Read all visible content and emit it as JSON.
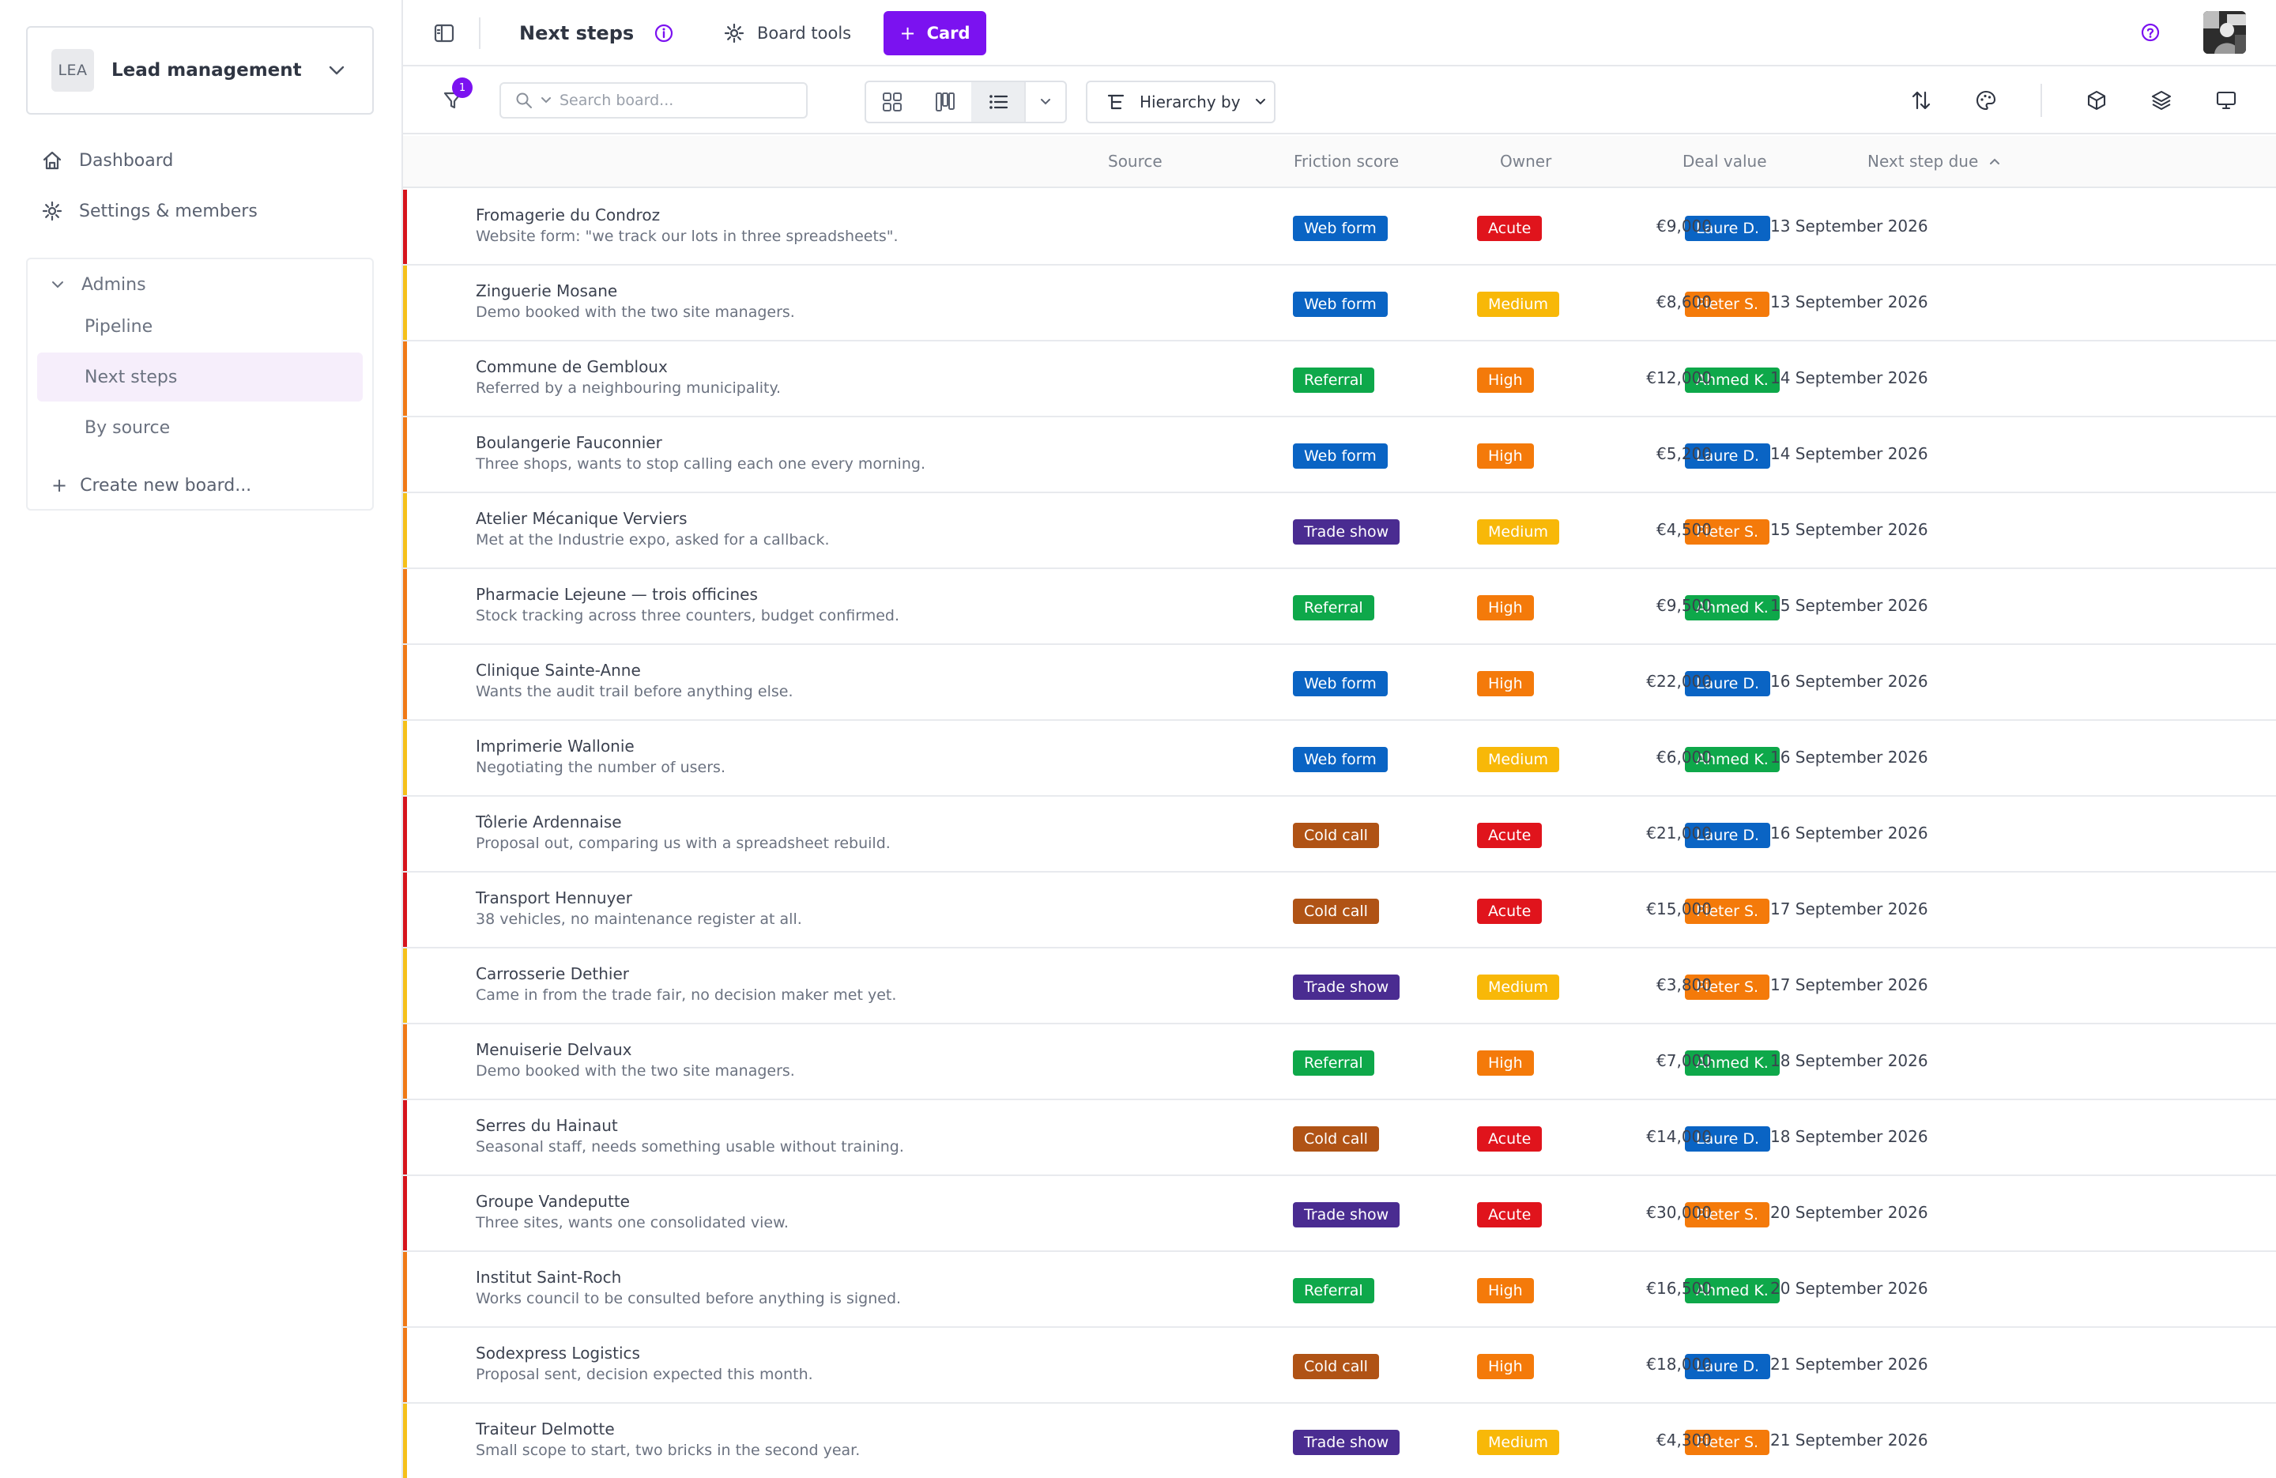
{
  "sidebar": {
    "workspace": {
      "initials": "LEA",
      "name": "Lead management"
    },
    "nav": [
      {
        "label": "Dashboard",
        "icon": "home-icon"
      },
      {
        "label": "Settings & members",
        "icon": "gear-icon"
      }
    ],
    "group": {
      "label": "Admins",
      "items": [
        {
          "label": "Pipeline",
          "active": false
        },
        {
          "label": "Next steps",
          "active": true
        },
        {
          "label": "By source",
          "active": false
        }
      ],
      "create_label": "Create new board..."
    }
  },
  "topbar": {
    "title": "Next steps",
    "board_tools_label": "Board tools",
    "card_button_label": "Card",
    "accent_color": "#7b12f0"
  },
  "toolbar": {
    "filter_count": "1",
    "search_placeholder": "Search board...",
    "hierarchy_label": "Hierarchy by"
  },
  "table": {
    "columns": {
      "source": "Source",
      "friction": "Friction score",
      "owner": "Owner",
      "value": "Deal value",
      "due": "Next step due"
    },
    "sort_column": "Next step due",
    "sort_direction": "ascending",
    "tag_colors": {
      "Web form": "#0a64c4",
      "Referral": "#0ea84a",
      "Trade show": "#4a2c91",
      "Cold call": "#b05315",
      "Acute": "#e0141c",
      "High": "#f47a0a",
      "Medium": "#f8b808",
      "Laure D.": "#0a64c4",
      "Pieter S.": "#f47a0a",
      "Ahmed K.": "#0ea84a"
    },
    "stripe_colors": {
      "Acute": "#d6141c",
      "High": "#f07a17",
      "Medium": "#f5c01a"
    },
    "rows": [
      {
        "title": "Fromagerie du Condroz",
        "desc": "Website form: \"we track our lots in three spreadsheets\".",
        "source": "Web form",
        "friction": "Acute",
        "owner": "Laure D.",
        "value": "€9,000",
        "due": "13 September 2026"
      },
      {
        "title": "Zinguerie Mosane",
        "desc": "Demo booked with the two site managers.",
        "source": "Web form",
        "friction": "Medium",
        "owner": "Pieter S.",
        "value": "€8,600",
        "due": "13 September 2026"
      },
      {
        "title": "Commune de Gembloux",
        "desc": "Referred by a neighbouring municipality.",
        "source": "Referral",
        "friction": "High",
        "owner": "Ahmed K.",
        "value": "€12,000",
        "due": "14 September 2026"
      },
      {
        "title": "Boulangerie Fauconnier",
        "desc": "Three shops, wants to stop calling each one every morning.",
        "source": "Web form",
        "friction": "High",
        "owner": "Laure D.",
        "value": "€5,200",
        "due": "14 September 2026"
      },
      {
        "title": "Atelier Mécanique Verviers",
        "desc": "Met at the Industrie expo, asked for a callback.",
        "source": "Trade show",
        "friction": "Medium",
        "owner": "Pieter S.",
        "value": "€4,500",
        "due": "15 September 2026"
      },
      {
        "title": "Pharmacie Lejeune — trois officines",
        "desc": "Stock tracking across three counters, budget confirmed.",
        "source": "Referral",
        "friction": "High",
        "owner": "Ahmed K.",
        "value": "€9,500",
        "due": "15 September 2026"
      },
      {
        "title": "Clinique Sainte-Anne",
        "desc": "Wants the audit trail before anything else.",
        "source": "Web form",
        "friction": "High",
        "owner": "Laure D.",
        "value": "€22,000",
        "due": "16 September 2026"
      },
      {
        "title": "Imprimerie Wallonie",
        "desc": "Negotiating the number of users.",
        "source": "Web form",
        "friction": "Medium",
        "owner": "Ahmed K.",
        "value": "€6,000",
        "due": "16 September 2026"
      },
      {
        "title": "Tôlerie Ardennaise",
        "desc": "Proposal out, comparing us with a spreadsheet rebuild.",
        "source": "Cold call",
        "friction": "Acute",
        "owner": "Laure D.",
        "value": "€21,000",
        "due": "16 September 2026"
      },
      {
        "title": "Transport Hennuyer",
        "desc": "38 vehicles, no maintenance register at all.",
        "source": "Cold call",
        "friction": "Acute",
        "owner": "Pieter S.",
        "value": "€15,000",
        "due": "17 September 2026"
      },
      {
        "title": "Carrosserie Dethier",
        "desc": "Came in from the trade fair, no decision maker met yet.",
        "source": "Trade show",
        "friction": "Medium",
        "owner": "Pieter S.",
        "value": "€3,800",
        "due": "17 September 2026"
      },
      {
        "title": "Menuiserie Delvaux",
        "desc": "Demo booked with the two site managers.",
        "source": "Referral",
        "friction": "High",
        "owner": "Ahmed K.",
        "value": "€7,000",
        "due": "18 September 2026"
      },
      {
        "title": "Serres du Hainaut",
        "desc": "Seasonal staff, needs something usable without training.",
        "source": "Cold call",
        "friction": "Acute",
        "owner": "Laure D.",
        "value": "€14,000",
        "due": "18 September 2026"
      },
      {
        "title": "Groupe Vandeputte",
        "desc": "Three sites, wants one consolidated view.",
        "source": "Trade show",
        "friction": "Acute",
        "owner": "Pieter S.",
        "value": "€30,000",
        "due": "20 September 2026"
      },
      {
        "title": "Institut Saint-Roch",
        "desc": "Works council to be consulted before anything is signed.",
        "source": "Referral",
        "friction": "High",
        "owner": "Ahmed K.",
        "value": "€16,500",
        "due": "20 September 2026"
      },
      {
        "title": "Sodexpress Logistics",
        "desc": "Proposal sent, decision expected this month.",
        "source": "Cold call",
        "friction": "High",
        "owner": "Laure D.",
        "value": "€18,000",
        "due": "21 September 2026"
      },
      {
        "title": "Traiteur Delmotte",
        "desc": "Small scope to start, two bricks in the second year.",
        "source": "Trade show",
        "friction": "Medium",
        "owner": "Pieter S.",
        "value": "€4,300",
        "due": "21 September 2026"
      }
    ]
  }
}
